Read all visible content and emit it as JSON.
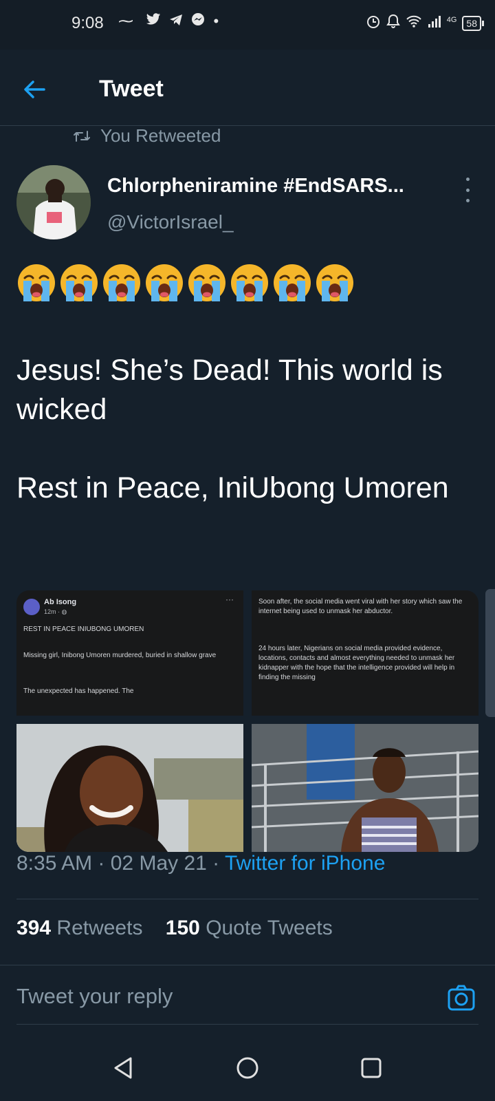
{
  "status_bar": {
    "time": "9:08",
    "left_icons": [
      "audio-wave-icon",
      "twitter-icon",
      "telegram-icon",
      "messenger-icon",
      "dot-icon"
    ],
    "right_icons": [
      "alarm-icon",
      "bell-icon",
      "wifi-icon",
      "signal-icon"
    ],
    "network": "4G",
    "battery": "58"
  },
  "header": {
    "title": "Tweet"
  },
  "retweet_context": {
    "label": "You Retweeted"
  },
  "author": {
    "name": "Chlorpheniramine #EndSARS...",
    "handle": "@VictorIsrael_"
  },
  "tweet": {
    "emoji_count": 8,
    "emoji_name": "loudly-crying-face",
    "paragraph_1": "Jesus! She’s Dead! This world is wicked",
    "paragraph_2": "Rest in Peace, IniUbong Umoren"
  },
  "media": {
    "card_1": {
      "poster": "Ab Isong",
      "time": "12m · ",
      "heading": "REST IN PEACE INIUBONG UMOREN",
      "line_1": "Missing girl, Inibong Umoren murdered, buried in shallow grave",
      "line_2": "The unexpected has happened. The"
    },
    "card_2": {
      "para_1": "Soon after, the social media went viral with her story which saw the internet being used to unmask her abductor.",
      "para_2": "24 hours later, Nigerians on social media provided evidence, locations, contacts and almost everything needed to unmask her kidnapper with the hope that the intelligence provided will help in finding the missing"
    }
  },
  "meta": {
    "time": "8:35 AM",
    "separator": " · ",
    "date": "02 May 21",
    "source": "Twitter for iPhone"
  },
  "stats": {
    "retweets_count": "394",
    "retweets_label": " Retweets",
    "quotes_count": "150",
    "quotes_label": " Quote Tweets"
  },
  "reply": {
    "placeholder": "Tweet your reply",
    "value": ""
  },
  "colors": {
    "background": "#15202b",
    "secondary_text": "#8899a6",
    "accent": "#1da1f2",
    "divider": "#2f3d4a"
  }
}
